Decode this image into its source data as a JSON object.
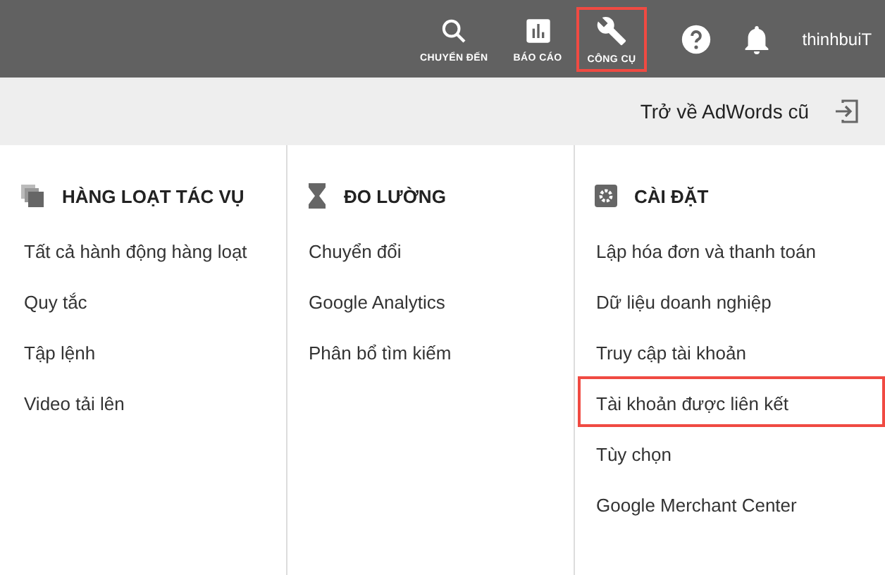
{
  "top_nav": {
    "items": [
      {
        "kind": "search",
        "label": "CHUYỂN ĐẾN",
        "highlighted": false
      },
      {
        "kind": "reports",
        "label": "BÁO CÁO",
        "highlighted": false
      },
      {
        "kind": "tools",
        "label": "CÔNG CỤ",
        "highlighted": true
      }
    ],
    "user": "thinhbuiT"
  },
  "sub_bar": {
    "link": "Trở về AdWords cũ"
  },
  "columns": [
    {
      "kind": "bulk",
      "title": "HÀNG LOẠT TÁC VỤ",
      "items": [
        {
          "label": "Tất cả hành động hàng loạt",
          "highlighted": false
        },
        {
          "label": "Quy tắc",
          "highlighted": false
        },
        {
          "label": "Tập lệnh",
          "highlighted": false
        },
        {
          "label": "Video tải lên",
          "highlighted": false
        }
      ]
    },
    {
      "kind": "measure",
      "title": "ĐO LƯỜNG",
      "items": [
        {
          "label": "Chuyển đổi",
          "highlighted": false
        },
        {
          "label": "Google Analytics",
          "highlighted": false
        },
        {
          "label": "Phân bổ tìm kiếm",
          "highlighted": false
        }
      ]
    },
    {
      "kind": "settings",
      "title": "CÀI ĐẶT",
      "items": [
        {
          "label": "Lập hóa đơn và thanh toán",
          "highlighted": false
        },
        {
          "label": "Dữ liệu doanh nghiệp",
          "highlighted": false
        },
        {
          "label": "Truy cập tài khoản",
          "highlighted": false
        },
        {
          "label": "Tài khoản được liên kết",
          "highlighted": true
        },
        {
          "label": "Tùy chọn",
          "highlighted": false
        },
        {
          "label": "Google Merchant Center",
          "highlighted": false
        }
      ]
    }
  ]
}
